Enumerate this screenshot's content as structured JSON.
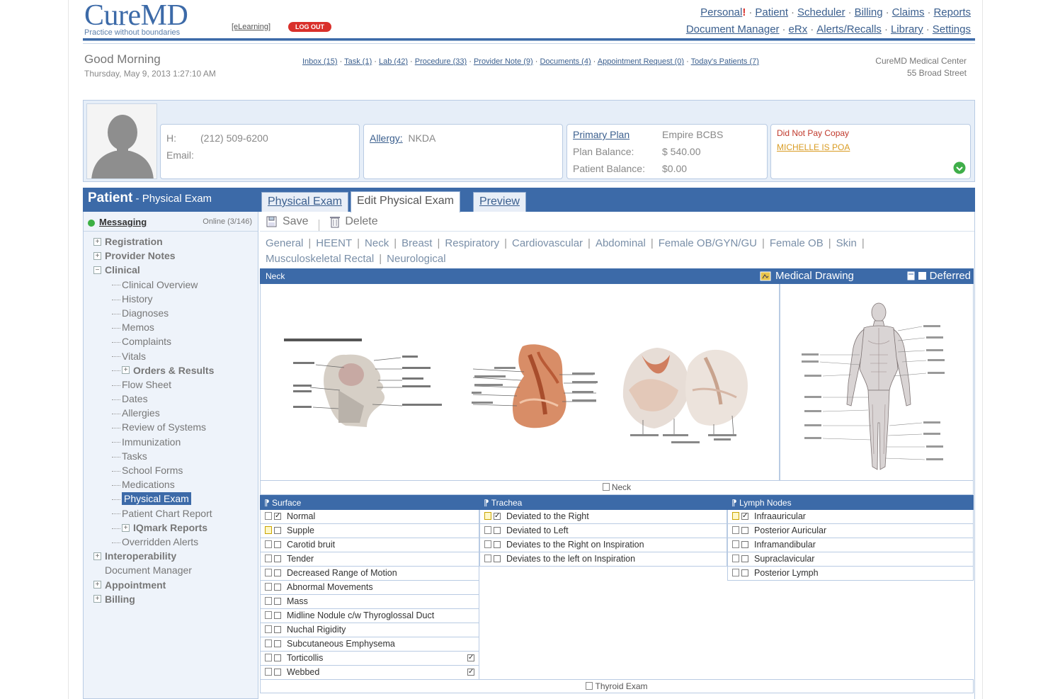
{
  "brand": {
    "name": "CureMD",
    "tagline": "Practice without boundaries",
    "elearning": "[eLearning]",
    "logout": "LOG OUT"
  },
  "topnav": {
    "row1": [
      "Personal",
      "Patient",
      "Scheduler",
      "Billing",
      "Claims",
      "Reports"
    ],
    "row2": [
      "Document Manager",
      "eRx",
      "Alerts/Recalls",
      "Library",
      "Settings"
    ],
    "alert_mark": "!"
  },
  "greeting": {
    "title": "Good Morning",
    "datetime": "Thursday, May 9, 2013 1:27:10 AM"
  },
  "quicklinks": [
    "Inbox (15)",
    "Task (1)",
    "Lab (42)",
    "Procedure (33)",
    "Provider Note (9)",
    "Documents (4)",
    "Appointment Request (0)",
    "Today's Patients (7)"
  ],
  "center": {
    "name": "CureMD Medical Center",
    "address": "55 Broad Street"
  },
  "patient": {
    "phone_label": "H:",
    "phone": "(212) 509-6200",
    "email_label": "Email:",
    "allergy_label": "Allergy:",
    "allergy": "NKDA",
    "plan_label": "Primary Plan",
    "plan": "Empire BCBS",
    "plan_balance_label": "Plan Balance:",
    "plan_balance": "$ 540.00",
    "patient_balance_label": "Patient Balance:",
    "patient_balance": "$0.00",
    "alert1": "Did Not Pay Copay",
    "alert2": "MICHELLE IS POA"
  },
  "ptbar": {
    "title": "Patient",
    "subtitle": " - Physical Exam"
  },
  "tabs": [
    "Physical Exam",
    "Edit Physical Exam",
    "Preview"
  ],
  "messaging": {
    "label": "Messaging",
    "status": "Online (3/146)"
  },
  "tree": [
    {
      "label": "Registration",
      "type": "plus"
    },
    {
      "label": "Provider Notes",
      "type": "plus"
    },
    {
      "label": "Clinical",
      "type": "minus"
    },
    {
      "label": "Clinical Overview",
      "type": "child"
    },
    {
      "label": "History",
      "type": "child"
    },
    {
      "label": "Diagnoses",
      "type": "child"
    },
    {
      "label": "Memos",
      "type": "child"
    },
    {
      "label": "Complaints",
      "type": "child"
    },
    {
      "label": "Vitals",
      "type": "child"
    },
    {
      "label": "Orders & Results",
      "type": "childplus"
    },
    {
      "label": "Flow Sheet",
      "type": "child"
    },
    {
      "label": "Dates",
      "type": "child"
    },
    {
      "label": "Allergies",
      "type": "child"
    },
    {
      "label": "Review of Systems",
      "type": "child"
    },
    {
      "label": "Immunization",
      "type": "child"
    },
    {
      "label": "Tasks",
      "type": "child"
    },
    {
      "label": "School Forms",
      "type": "child"
    },
    {
      "label": "Medications",
      "type": "child"
    },
    {
      "label": "Physical Exam",
      "type": "childsel"
    },
    {
      "label": "Patient Chart Report",
      "type": "child"
    },
    {
      "label": "IQmark Reports",
      "type": "childplus"
    },
    {
      "label": "Overridden Alerts",
      "type": "child"
    },
    {
      "label": "Interoperability",
      "type": "plus"
    },
    {
      "label": "Document Manager",
      "type": "none"
    },
    {
      "label": "Appointment",
      "type": "plus"
    },
    {
      "label": "Billing",
      "type": "plus"
    }
  ],
  "toolbar": {
    "save": "Save",
    "delete": "Delete"
  },
  "sections": [
    "General",
    "HEENT",
    "Neck",
    "Breast",
    "Respiratory",
    "Cardiovascular",
    "Abdominal",
    "Female OB/GYN/GU",
    "Female OB",
    "Skin",
    "Musculoskeletal",
    "Rectal",
    "Neurological"
  ],
  "neckbar": {
    "label": "Neck",
    "medical_drawing": "Medical Drawing",
    "deferred": "Deferred"
  },
  "drawing_caption": "Neck",
  "colors": {
    "accent": "#3c6aa8",
    "alert": "#d9302b"
  },
  "surface": {
    "title": "Surface",
    "items": [
      {
        "label": "Normal",
        "checked": true,
        "yellow": false,
        "right": false
      },
      {
        "label": "Supple",
        "checked": false,
        "yellow": true,
        "right": false
      },
      {
        "label": "Carotid bruit",
        "checked": false,
        "yellow": false,
        "right": false
      },
      {
        "label": "Tender",
        "checked": false,
        "yellow": false,
        "right": false
      },
      {
        "label": "Decreased Range of Motion",
        "checked": false,
        "yellow": false,
        "right": false
      },
      {
        "label": "Abnormal Movements",
        "checked": false,
        "yellow": false,
        "right": false
      },
      {
        "label": "Mass",
        "checked": false,
        "yellow": false,
        "right": false
      },
      {
        "label": "Midline Nodule c/w Thyroglossal Duct",
        "checked": false,
        "yellow": false,
        "right": false
      },
      {
        "label": "Nuchal Rigidity",
        "checked": false,
        "yellow": false,
        "right": false
      },
      {
        "label": "Subcutaneous Emphysema",
        "checked": false,
        "yellow": false,
        "right": false
      },
      {
        "label": "Torticollis",
        "checked": false,
        "yellow": false,
        "right": true
      },
      {
        "label": "Webbed",
        "checked": false,
        "yellow": false,
        "right": true
      }
    ]
  },
  "trachea": {
    "title": "Trachea",
    "items": [
      {
        "label": "Deviated to the Right",
        "checked": true,
        "yellow": true
      },
      {
        "label": "Deviated to Left",
        "checked": false,
        "yellow": false
      },
      {
        "label": "Deviates to the Right on Inspiration",
        "checked": false,
        "yellow": false
      },
      {
        "label": "Deviates to the left on Inspiration",
        "checked": false,
        "yellow": false
      }
    ]
  },
  "lymph": {
    "title": "Lymph Nodes",
    "items": [
      {
        "label": "Infraauricular",
        "checked": true,
        "yellow": true
      },
      {
        "label": "Posterior Auricular",
        "checked": false,
        "yellow": false
      },
      {
        "label": "Inframandibular",
        "checked": false,
        "yellow": false
      },
      {
        "label": "Supraclavicular",
        "checked": false,
        "yellow": false
      },
      {
        "label": "Posterior Lymph",
        "checked": false,
        "yellow": false
      }
    ]
  },
  "thyroid_caption": "Thyroid Exam"
}
